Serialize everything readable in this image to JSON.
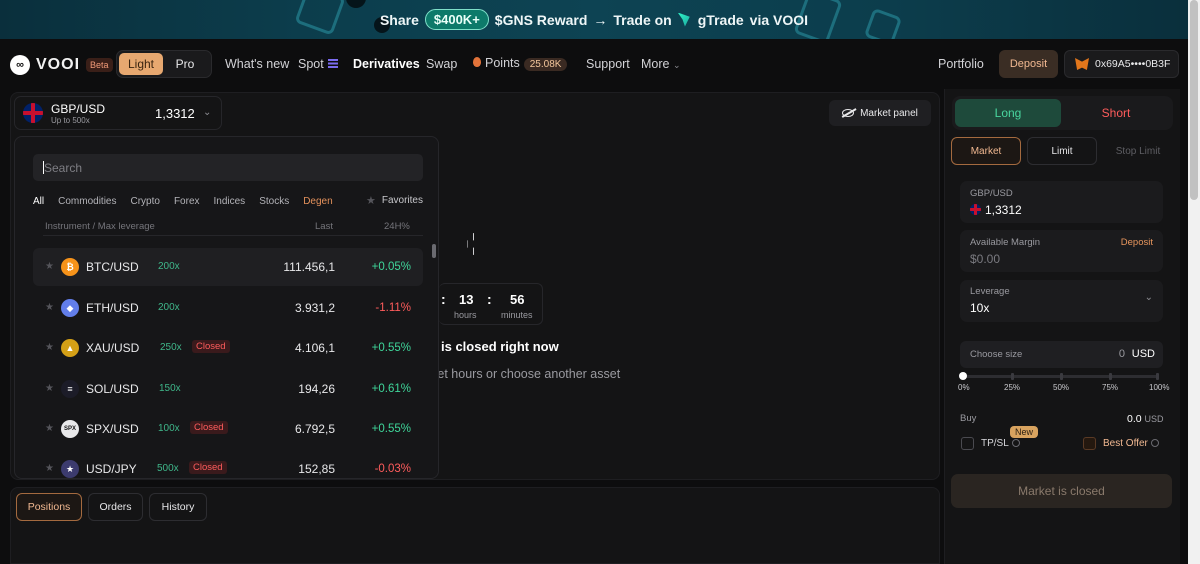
{
  "banner": {
    "share": "Share",
    "amount": "$400K+",
    "reward": "$GNS Reward",
    "arrow": "→",
    "trade_on": "Trade on",
    "gtrade": "gTrade",
    "via": "via VOOI"
  },
  "brand": {
    "logo_mark": "∞",
    "name": "VOOI",
    "badge": "Beta"
  },
  "mode": {
    "light": "Light",
    "pro": "Pro",
    "selected": "Light"
  },
  "nav": {
    "whats_new": "What's new",
    "spot": "Spot",
    "derivatives": "Derivatives",
    "swap": "Swap",
    "points": "Points",
    "points_value": "25.08K",
    "support": "Support",
    "more": "More",
    "portfolio": "Portfolio",
    "deposit": "Deposit",
    "wallet": "0x69A5••••0B3F"
  },
  "pair": {
    "name": "GBP/USD",
    "subtitle": "Up to 500x",
    "price": "1,3312"
  },
  "market_panel": {
    "label": "Market panel"
  },
  "dropdown": {
    "search_placeholder": "Search",
    "filters": [
      "All",
      "Commodities",
      "Crypto",
      "Forex",
      "Indices",
      "Stocks",
      "Degen"
    ],
    "active_filter": "All",
    "favorites": "Favorites",
    "header_instrument": "Instrument / Max leverage",
    "header_last": "Last",
    "header_24h": "24H%",
    "rows": [
      {
        "symbol": "BTC/USD",
        "leverage": "200x",
        "closed": "",
        "last": "111.456,1",
        "change": "+0.05%",
        "dir": "up",
        "icon": "bitcoin-icon",
        "glyph": "₿",
        "color": "#f7931a"
      },
      {
        "symbol": "ETH/USD",
        "leverage": "200x",
        "closed": "",
        "last": "3.931,2",
        "change": "-1.11%",
        "dir": "down",
        "icon": "ethereum-icon",
        "glyph": "◆",
        "color": "#627eea"
      },
      {
        "symbol": "XAU/USD",
        "leverage": "250x",
        "closed": "Closed",
        "last": "4.106,1",
        "change": "+0.55%",
        "dir": "up",
        "icon": "gold-icon",
        "glyph": "▲",
        "color": "#d4a017"
      },
      {
        "symbol": "SOL/USD",
        "leverage": "150x",
        "closed": "",
        "last": "194,26",
        "change": "+0.61%",
        "dir": "up",
        "icon": "solana-icon",
        "glyph": "≡",
        "color": "#1c1c28"
      },
      {
        "symbol": "SPX/USD",
        "leverage": "100x",
        "closed": "Closed",
        "last": "6.792,5",
        "change": "+0.55%",
        "dir": "up",
        "icon": "spx-icon",
        "glyph": "SPX",
        "color": "#3a3a3f"
      },
      {
        "symbol": "USD/JPY",
        "leverage": "500x",
        "closed": "Closed",
        "last": "152,85",
        "change": "-0.03%",
        "dir": "down",
        "icon": "us-flag-icon",
        "glyph": "★",
        "color": "#3c3b6e"
      }
    ]
  },
  "closed_notice": {
    "face": "–_–",
    "hours": "13",
    "hours_label": "hours",
    "minutes": "56",
    "minutes_label": "minutes",
    "title": "is closed right now",
    "subtitle": "rket hours or choose another asset"
  },
  "bottom_tabs": {
    "positions": "Positions",
    "orders": "Orders",
    "history": "History",
    "active": "Positions"
  },
  "trade": {
    "long": "Long",
    "short": "Short",
    "side": "Long",
    "order_market": "Market",
    "order_limit": "Limit",
    "order_stop": "Stop Limit",
    "pair_label": "GBP/USD",
    "pair_price": "1,3312",
    "margin_label": "Available Margin",
    "margin_deposit": "Deposit",
    "margin_value": "$0.00",
    "leverage_label": "Leverage",
    "leverage_value": "10x",
    "size_placeholder": "Choose size",
    "size_value": "0",
    "size_unit": "USD",
    "slider_marks": [
      "0%",
      "25%",
      "50%",
      "75%",
      "100%"
    ],
    "slider_value": 0,
    "buy_label": "Buy",
    "buy_value": "0.0",
    "buy_unit": "USD",
    "new_badge": "New",
    "tpsl_label": "TP/SL",
    "best_offer_label": "Best Offer",
    "submit": "Market is closed"
  }
}
